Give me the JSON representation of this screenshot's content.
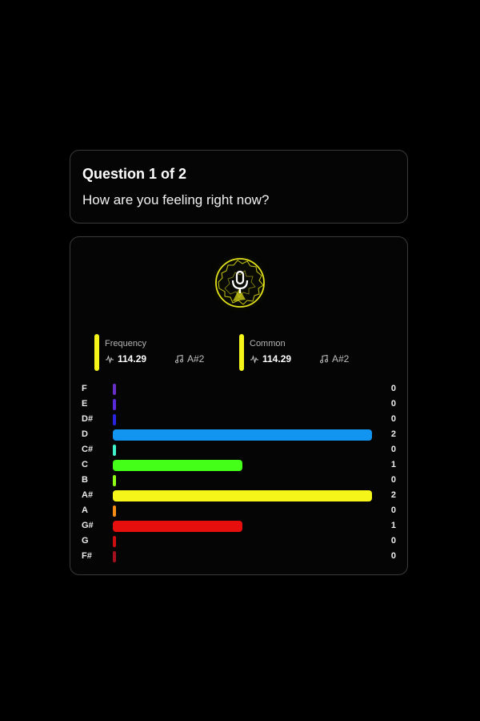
{
  "question": {
    "title": "Question 1 of 2",
    "text": "How are you feeling right now?"
  },
  "mic": {
    "icon": "microphone-icon",
    "accent": "#f5f51a"
  },
  "stats": {
    "frequency": {
      "label": "Frequency",
      "value": "114.29",
      "note": "A#2",
      "accent": "#f5f51a"
    },
    "common": {
      "label": "Common",
      "value": "114.29",
      "note": "A#2",
      "accent": "#f5f51a"
    }
  },
  "notes": {
    "max": 2,
    "items": [
      {
        "name": "F",
        "count": 0,
        "color": "#6a2fc9"
      },
      {
        "name": "E",
        "count": 0,
        "color": "#5a2ad9"
      },
      {
        "name": "D#",
        "count": 0,
        "color": "#2a24e0"
      },
      {
        "name": "D",
        "count": 2,
        "color": "#1295f0"
      },
      {
        "name": "C#",
        "count": 0,
        "color": "#3ff2c9"
      },
      {
        "name": "C",
        "count": 1,
        "color": "#44ff18"
      },
      {
        "name": "B",
        "count": 0,
        "color": "#90ff18"
      },
      {
        "name": "A#",
        "count": 2,
        "color": "#f5f51a"
      },
      {
        "name": "A",
        "count": 0,
        "color": "#f58c14"
      },
      {
        "name": "G#",
        "count": 1,
        "color": "#e70e0e"
      },
      {
        "name": "G",
        "count": 0,
        "color": "#cc0e0e"
      },
      {
        "name": "F#",
        "count": 0,
        "color": "#a5101c"
      }
    ]
  }
}
